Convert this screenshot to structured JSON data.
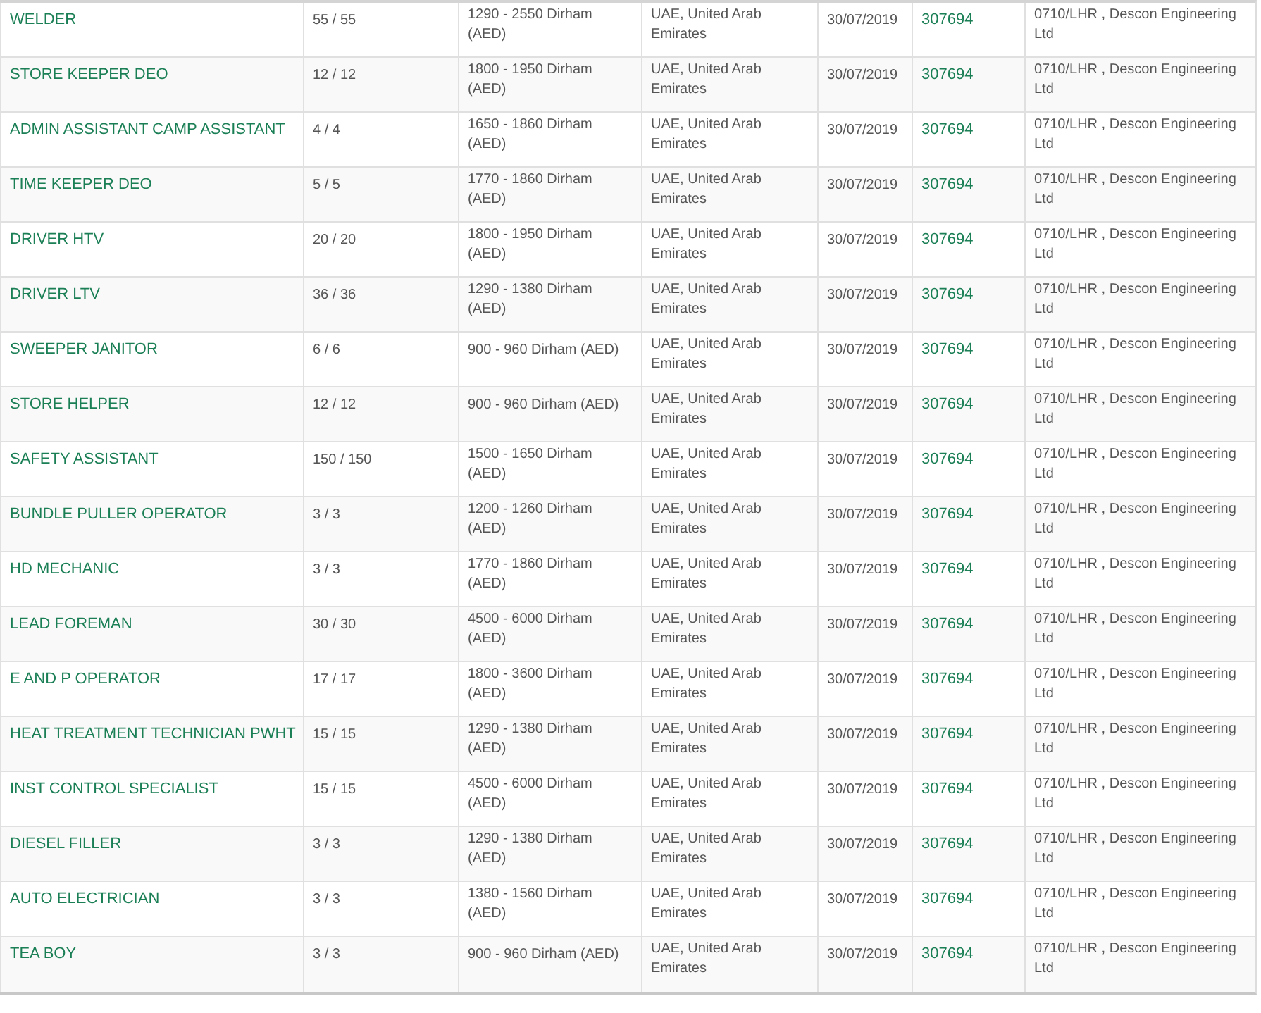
{
  "jobs": [
    {
      "title": "WELDER",
      "count": "55 / 55",
      "salary": "1290 - 2550 Dirham (AED)",
      "location": "UAE, United Arab Emirates",
      "date": "30/07/2019",
      "id": "307694",
      "company": "0710/LHR , Descon Engineering Ltd"
    },
    {
      "title": "STORE KEEPER DEO",
      "count": "12 / 12",
      "salary": "1800 - 1950 Dirham (AED)",
      "location": "UAE, United Arab Emirates",
      "date": "30/07/2019",
      "id": "307694",
      "company": "0710/LHR , Descon Engineering Ltd"
    },
    {
      "title": "ADMIN ASSISTANT CAMP ASSISTANT",
      "count": "4 / 4",
      "salary": "1650 - 1860 Dirham (AED)",
      "location": "UAE, United Arab Emirates",
      "date": "30/07/2019",
      "id": "307694",
      "company": "0710/LHR , Descon Engineering Ltd"
    },
    {
      "title": "TIME KEEPER DEO",
      "count": "5 / 5",
      "salary": "1770 - 1860 Dirham (AED)",
      "location": "UAE, United Arab Emirates",
      "date": "30/07/2019",
      "id": "307694",
      "company": "0710/LHR , Descon Engineering Ltd"
    },
    {
      "title": "DRIVER HTV",
      "count": "20 / 20",
      "salary": "1800 - 1950 Dirham (AED)",
      "location": "UAE, United Arab Emirates",
      "date": "30/07/2019",
      "id": "307694",
      "company": "0710/LHR , Descon Engineering Ltd"
    },
    {
      "title": "DRIVER LTV",
      "count": "36 / 36",
      "salary": "1290 - 1380 Dirham (AED)",
      "location": "UAE, United Arab Emirates",
      "date": "30/07/2019",
      "id": "307694",
      "company": "0710/LHR , Descon Engineering Ltd"
    },
    {
      "title": "SWEEPER JANITOR",
      "count": "6 / 6",
      "salary": "900 - 960 Dirham (AED)",
      "location": "UAE, United Arab Emirates",
      "date": "30/07/2019",
      "id": "307694",
      "company": "0710/LHR , Descon Engineering Ltd"
    },
    {
      "title": "STORE HELPER",
      "count": "12 / 12",
      "salary": "900 - 960 Dirham (AED)",
      "location": "UAE, United Arab Emirates",
      "date": "30/07/2019",
      "id": "307694",
      "company": "0710/LHR , Descon Engineering Ltd"
    },
    {
      "title": "SAFETY ASSISTANT",
      "count": "150 / 150",
      "salary": "1500 - 1650 Dirham (AED)",
      "location": "UAE, United Arab Emirates",
      "date": "30/07/2019",
      "id": "307694",
      "company": "0710/LHR , Descon Engineering Ltd"
    },
    {
      "title": "BUNDLE PULLER OPERATOR",
      "count": "3 / 3",
      "salary": "1200 - 1260 Dirham (AED)",
      "location": "UAE, United Arab Emirates",
      "date": "30/07/2019",
      "id": "307694",
      "company": "0710/LHR , Descon Engineering Ltd"
    },
    {
      "title": "HD MECHANIC",
      "count": "3 / 3",
      "salary": "1770 - 1860 Dirham (AED)",
      "location": "UAE, United Arab Emirates",
      "date": "30/07/2019",
      "id": "307694",
      "company": "0710/LHR , Descon Engineering Ltd"
    },
    {
      "title": "LEAD FOREMAN",
      "count": "30 / 30",
      "salary": "4500 - 6000 Dirham (AED)",
      "location": "UAE, United Arab Emirates",
      "date": "30/07/2019",
      "id": "307694",
      "company": "0710/LHR , Descon Engineering Ltd"
    },
    {
      "title": "E AND P OPERATOR",
      "count": "17 / 17",
      "salary": "1800 - 3600 Dirham (AED)",
      "location": "UAE, United Arab Emirates",
      "date": "30/07/2019",
      "id": "307694",
      "company": "0710/LHR , Descon Engineering Ltd"
    },
    {
      "title": "HEAT TREATMENT TECHNICIAN PWHT",
      "count": "15 / 15",
      "salary": "1290 - 1380 Dirham (AED)",
      "location": "UAE, United Arab Emirates",
      "date": "30/07/2019",
      "id": "307694",
      "company": "0710/LHR , Descon Engineering Ltd"
    },
    {
      "title": "INST CONTROL SPECIALIST",
      "count": "15 / 15",
      "salary": "4500 - 6000 Dirham (AED)",
      "location": "UAE, United Arab Emirates",
      "date": "30/07/2019",
      "id": "307694",
      "company": "0710/LHR , Descon Engineering Ltd"
    },
    {
      "title": "DIESEL FILLER",
      "count": "3 / 3",
      "salary": "1290 - 1380 Dirham (AED)",
      "location": "UAE, United Arab Emirates",
      "date": "30/07/2019",
      "id": "307694",
      "company": "0710/LHR , Descon Engineering Ltd"
    },
    {
      "title": "AUTO ELECTRICIAN",
      "count": "3 / 3",
      "salary": "1380 - 1560 Dirham (AED)",
      "location": "UAE, United Arab Emirates",
      "date": "30/07/2019",
      "id": "307694",
      "company": "0710/LHR , Descon Engineering Ltd"
    },
    {
      "title": "TEA BOY",
      "count": "3 / 3",
      "salary": "900 - 960 Dirham (AED)",
      "location": "UAE, United Arab Emirates",
      "date": "30/07/2019",
      "id": "307694",
      "company": "0710/LHR , Descon Engineering Ltd"
    }
  ]
}
